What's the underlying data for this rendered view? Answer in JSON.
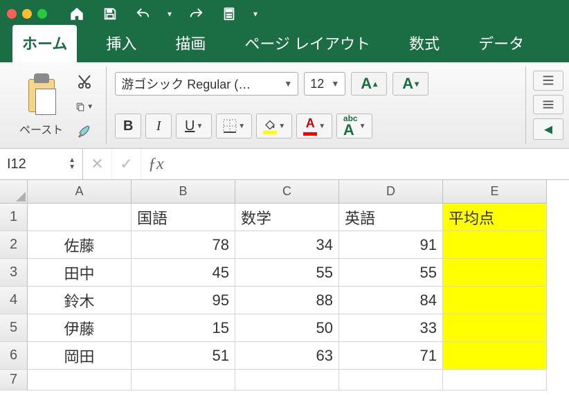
{
  "window": {
    "traffic": [
      "close",
      "minimize",
      "zoom"
    ]
  },
  "qat": {
    "home": "home",
    "save": "save",
    "undo": "undo",
    "redo": "redo",
    "calc": "calc",
    "more": "more"
  },
  "tabs": [
    {
      "id": "home",
      "label": "ホーム",
      "active": true
    },
    {
      "id": "insert",
      "label": "挿入",
      "active": false
    },
    {
      "id": "draw",
      "label": "描画",
      "active": false
    },
    {
      "id": "layout",
      "label": "ページ レイアウト",
      "active": false
    },
    {
      "id": "formulas",
      "label": "数式",
      "active": false
    },
    {
      "id": "data",
      "label": "データ",
      "active": false
    }
  ],
  "ribbon": {
    "paste_label": "ペースト",
    "font_name": "游ゴシック Regular (…",
    "font_size": "12",
    "bold": "B",
    "italic": "I",
    "underline": "U",
    "phonetic_top": "abc",
    "phonetic_bottom": "A"
  },
  "namebox": "I12",
  "formula": "",
  "colors": {
    "ribbon_green": "#1b6e43",
    "fill_highlight": "#ffff00",
    "font_color": "#ff0000"
  },
  "columns": [
    "A",
    "B",
    "C",
    "D",
    "E"
  ],
  "rows": [
    1,
    2,
    3,
    4,
    5,
    6,
    7
  ],
  "sheet": {
    "headers": {
      "B": "国語",
      "C": "数学",
      "D": "英語",
      "E": "平均点"
    },
    "data": [
      {
        "A": "佐藤",
        "B": 78,
        "C": 34,
        "D": 91
      },
      {
        "A": "田中",
        "B": 45,
        "C": 55,
        "D": 55
      },
      {
        "A": "鈴木",
        "B": 95,
        "C": 88,
        "D": 84
      },
      {
        "A": "伊藤",
        "B": 15,
        "C": 50,
        "D": 33
      },
      {
        "A": "岡田",
        "B": 51,
        "C": 63,
        "D": 71
      }
    ],
    "highlight_column": "E"
  },
  "chart_data": {
    "type": "table",
    "columns": [
      "国語",
      "数学",
      "英語"
    ],
    "rows": [
      "佐藤",
      "田中",
      "鈴木",
      "伊藤",
      "岡田"
    ],
    "values": [
      [
        78,
        34,
        91
      ],
      [
        45,
        55,
        55
      ],
      [
        95,
        88,
        84
      ],
      [
        15,
        50,
        33
      ],
      [
        51,
        63,
        71
      ]
    ],
    "derived_column": "平均点"
  }
}
